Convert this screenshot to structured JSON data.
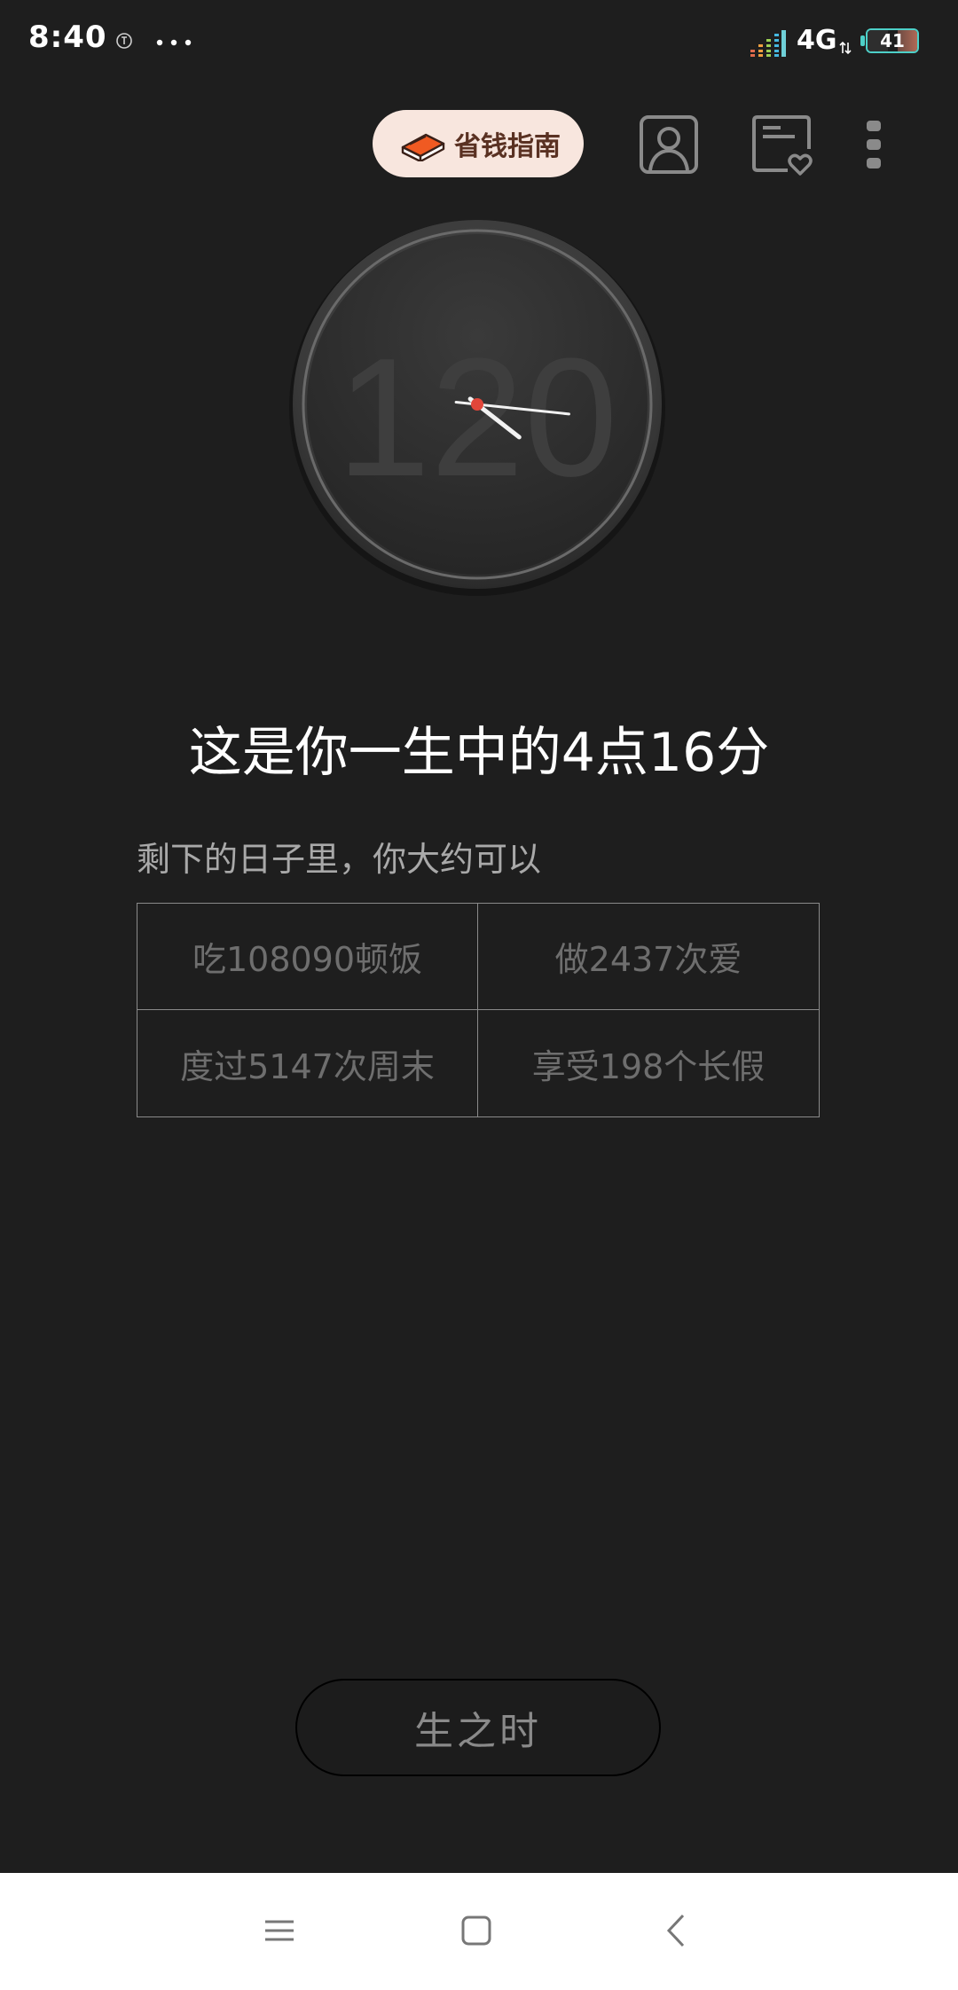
{
  "status_bar": {
    "time": "8:40",
    "network": "4G",
    "battery": "41",
    "icons": [
      "app-notification-icon",
      "more-dots-icon",
      "signal-icon",
      "network-arrows-icon",
      "battery-icon"
    ]
  },
  "toolbar": {
    "guide_label": "省钱指南",
    "guide_icon": "book-icon",
    "profile_icon": "user-icon",
    "favorites_icon": "heart-card-icon",
    "more_icon": "more-vertical-icon"
  },
  "clock": {
    "number": "120",
    "hour": 4,
    "minute": 16,
    "accent_color": "#e2463a"
  },
  "main": {
    "headline": "这是你一生中的4点16分",
    "subtitle": "剩下的日子里，你大约可以"
  },
  "stats": [
    {
      "text": "吃108090顿饭"
    },
    {
      "text": "做2437次爱"
    },
    {
      "text": "度过5147次周末"
    },
    {
      "text": "享受198个长假"
    }
  ],
  "main_button": {
    "label": "生之时"
  },
  "nav": {
    "icons": [
      "menu-icon",
      "home-icon",
      "back-icon"
    ]
  },
  "colors": {
    "background": "#1e1e1e",
    "guide_bg": "#f8e6de",
    "guide_text": "#5a3122",
    "battery_outline": "#4dd0c8"
  }
}
